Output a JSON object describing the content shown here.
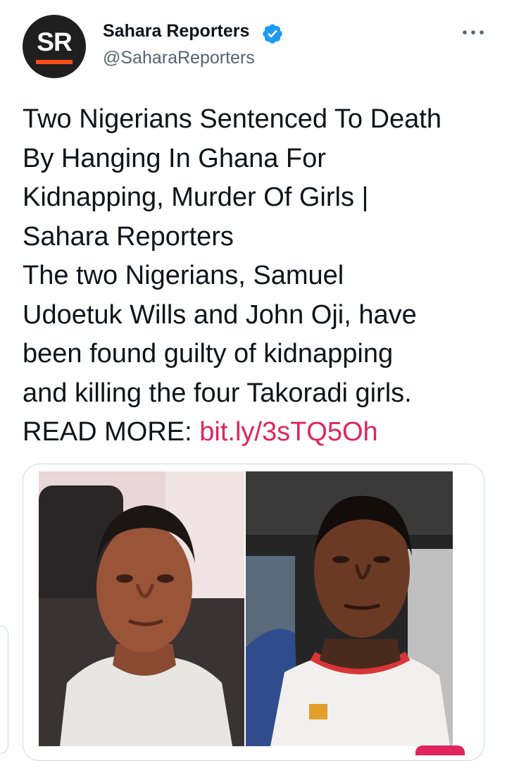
{
  "header": {
    "avatar_text": "SR",
    "display_name": "Sahara Reporters",
    "handle": "@SaharaReporters",
    "verified_icon": "verified-badge-icon",
    "more_icon": "more-options-icon"
  },
  "tweet": {
    "lines": [
      "Two Nigerians Sentenced To Death",
      "By Hanging In Ghana For",
      "Kidnapping, Murder Of Girls |",
      "Sahara Reporters",
      "The two Nigerians, Samuel",
      "Udoetuk Wills and John Oji, have",
      "been found guilty of kidnapping",
      "and killing the four Takoradi girls."
    ],
    "read_more_label": "READ MORE: ",
    "link_text": "bit.ly/3sTQ5Oh"
  },
  "card": {
    "images": [
      "photo-portrait-left",
      "photo-portrait-right"
    ]
  },
  "colors": {
    "text": "#0f1419",
    "secondary": "#536471",
    "link": "#e0245e",
    "verified": "#1d9bf0",
    "brand_orange": "#ff4d1a"
  }
}
